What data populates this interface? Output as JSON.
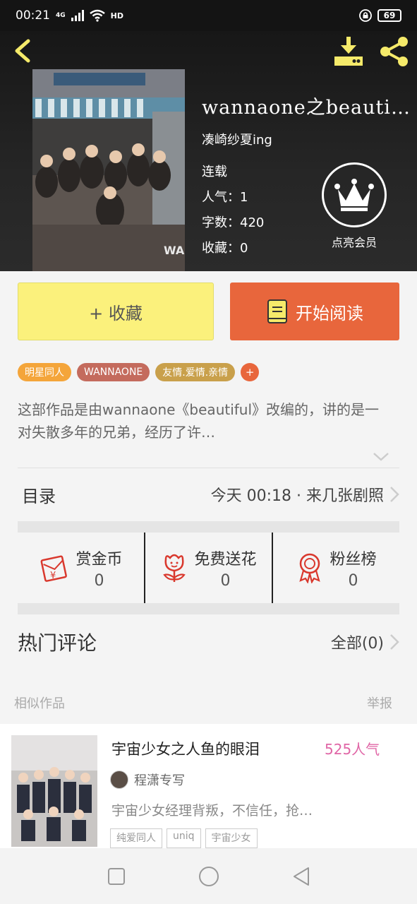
{
  "status_bar": {
    "time": "00:21",
    "network": "4G",
    "hd": "HD",
    "battery": "69"
  },
  "book": {
    "title": "wannaone之beauti…",
    "author": "凑崎纱夏ing",
    "status": "连载",
    "popularity": "人气：1",
    "word_count": "字数：420",
    "favorites": "收藏：0",
    "vip_label": "点亮会员"
  },
  "actions": {
    "collect_label": "+ 收藏",
    "read_label": "开始阅读"
  },
  "tags": [
    {
      "label": "明星同人",
      "color": "#f4a53a"
    },
    {
      "label": "WANNAONE",
      "color": "#c46b5d"
    },
    {
      "label": "友情.爱情.亲情",
      "color": "#c9a04b"
    }
  ],
  "tag_add": "+",
  "description": "这部作品是由wannaone《beautiful》改编的，讲的是一对失散多年的兄弟，经历了许…",
  "toc": {
    "label": "目录",
    "latest": "今天 00:18 · 来几张剧照"
  },
  "rewards": [
    {
      "label": "赏金币",
      "count": "0",
      "icon": "red-envelope-icon"
    },
    {
      "label": "免费送花",
      "count": "0",
      "icon": "flower-icon"
    },
    {
      "label": "粉丝榜",
      "count": "0",
      "icon": "medal-icon"
    }
  ],
  "comments": {
    "label": "热门评论",
    "all": "全部(0)"
  },
  "similar": {
    "label": "相似作品",
    "report": "举报"
  },
  "similar_item": {
    "title": "宇宙少女之人鱼的眼泪",
    "popularity": "525人气",
    "author": "程潇专写",
    "desc": "宇宙少女经理背叛，不信任，抢…",
    "tags": [
      "纯爱同人",
      "uniq",
      "宇宙少女"
    ]
  },
  "colors": {
    "accent": "#e8663c",
    "collect": "#fbf17c",
    "icon_yellow": "#f5ea6a",
    "reward_red": "#d9382d"
  }
}
